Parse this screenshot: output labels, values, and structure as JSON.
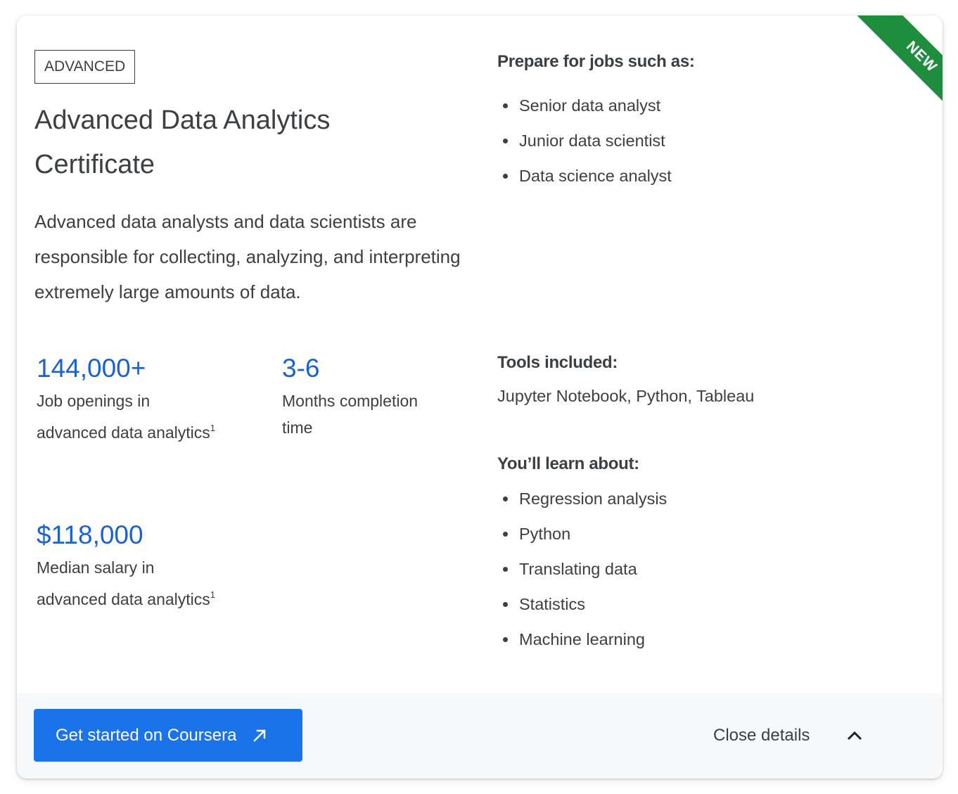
{
  "ribbon": {
    "label": "NEW",
    "color": "#1e8e3e"
  },
  "level": "ADVANCED",
  "title": "Advanced Data Analytics Certificate",
  "description": "Advanced data analysts and data scientists are responsible for collecting, analyzing, and interpreting extremely large amounts of data.",
  "stats": {
    "jobs": {
      "value": "144,000+",
      "label": "Job openings in advanced data analytics",
      "footnote": "1"
    },
    "months": {
      "value": "3-6",
      "label": "Months completion time"
    },
    "salary": {
      "value": "$118,000",
      "label": "Median salary in advanced data analytics",
      "footnote": "1"
    }
  },
  "jobs": {
    "heading": "Prepare for jobs such as:",
    "items": [
      "Senior data analyst",
      "Junior data scientist",
      "Data science analyst"
    ]
  },
  "tools": {
    "heading": "Tools included:",
    "text": "Jupyter Notebook, Python, Tableau"
  },
  "learn": {
    "heading": "You’ll learn about:",
    "items": [
      "Regression analysis",
      "Python",
      "Translating data",
      "Statistics",
      "Machine learning"
    ]
  },
  "footer": {
    "cta_label": "Get started on Coursera",
    "cta_icon": "external-arrow-icon",
    "close_label": "Close details",
    "close_icon": "chevron-up-icon"
  },
  "colors": {
    "accent": "#1a73e8",
    "stat": "#1a62d0",
    "text": "#3c4043"
  }
}
